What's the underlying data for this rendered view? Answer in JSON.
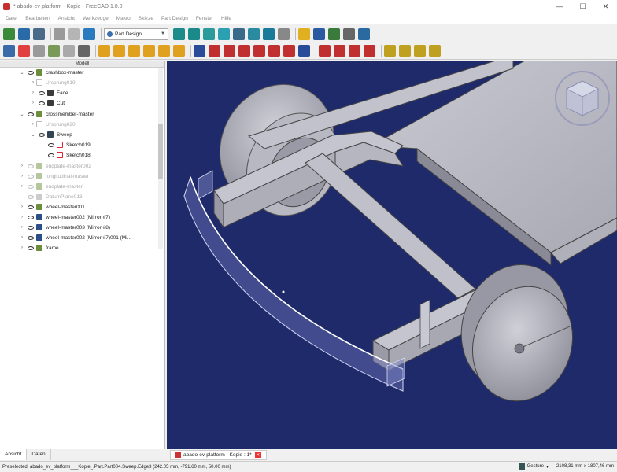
{
  "window": {
    "title": "* abado-ev-platform - Kopie - FreeCAD 1.0.0",
    "minimize": "—",
    "maximize": "☐",
    "close": "✕"
  },
  "menu": [
    "Datei",
    "Bearbeiten",
    "Ansicht",
    "Werkzeuge",
    "Makro",
    "Skizze",
    "Part Design",
    "Fenster",
    "Hilfe"
  ],
  "toolbar": {
    "workbench": "Part Design"
  },
  "tree": {
    "header": "Modell",
    "items": [
      {
        "label": "crashbox-master",
        "icon": "body-icon",
        "faded": false
      },
      {
        "label": "Ursprung019",
        "icon": "origin-icon",
        "faded": true
      },
      {
        "label": "Face",
        "icon": "face-icon",
        "faded": false
      },
      {
        "label": "Cut",
        "icon": "cut-icon",
        "faded": false
      },
      {
        "label": "crossmember-master",
        "icon": "body-icon",
        "faded": false
      },
      {
        "label": "Ursprung020",
        "icon": "origin-icon",
        "faded": true
      },
      {
        "label": "Sweep",
        "icon": "sweep-icon",
        "faded": false
      },
      {
        "label": "Sketch019",
        "icon": "sketch-icon",
        "faded": false
      },
      {
        "label": "Sketch018",
        "icon": "sketch-icon",
        "faded": false
      },
      {
        "label": "endplate-master002",
        "icon": "body-icon",
        "faded": true
      },
      {
        "label": "longitudinal-master",
        "icon": "body-icon",
        "faded": true
      },
      {
        "label": "endplate-master",
        "icon": "body-icon",
        "faded": true
      },
      {
        "label": "DatumPlane013",
        "icon": "datum-icon",
        "faded": true
      },
      {
        "label": "wheel-master001",
        "icon": "body-icon",
        "faded": false
      },
      {
        "label": "wheel-master002 (Mirror #7)",
        "icon": "link-icon",
        "faded": false
      },
      {
        "label": "wheel-master003 (Mirror #8)",
        "icon": "link-icon",
        "faded": false
      },
      {
        "label": "wheel-master002 (Mirror #7)001 (Mi...",
        "icon": "link-icon",
        "faded": false
      },
      {
        "label": "frame",
        "icon": "body-icon",
        "faded": false
      }
    ]
  },
  "panel_tabs": [
    "Ansicht",
    "Daten"
  ],
  "document_tab": "abado-ev-platform - Kopie : 1*",
  "status": {
    "preselected": "Preselected: abado_ev_platform___Kopie_.Part.Part004.Sweep.Edge3 (242.05 mm, -791.60 mm, 50.00 mm)",
    "nav_style": "Gesture",
    "dimensions": "2108,31 mm x 1807,46 mm"
  },
  "colors": {
    "viewport_bg": "#1f2a6b",
    "model_gray": "#b5b5bd"
  }
}
